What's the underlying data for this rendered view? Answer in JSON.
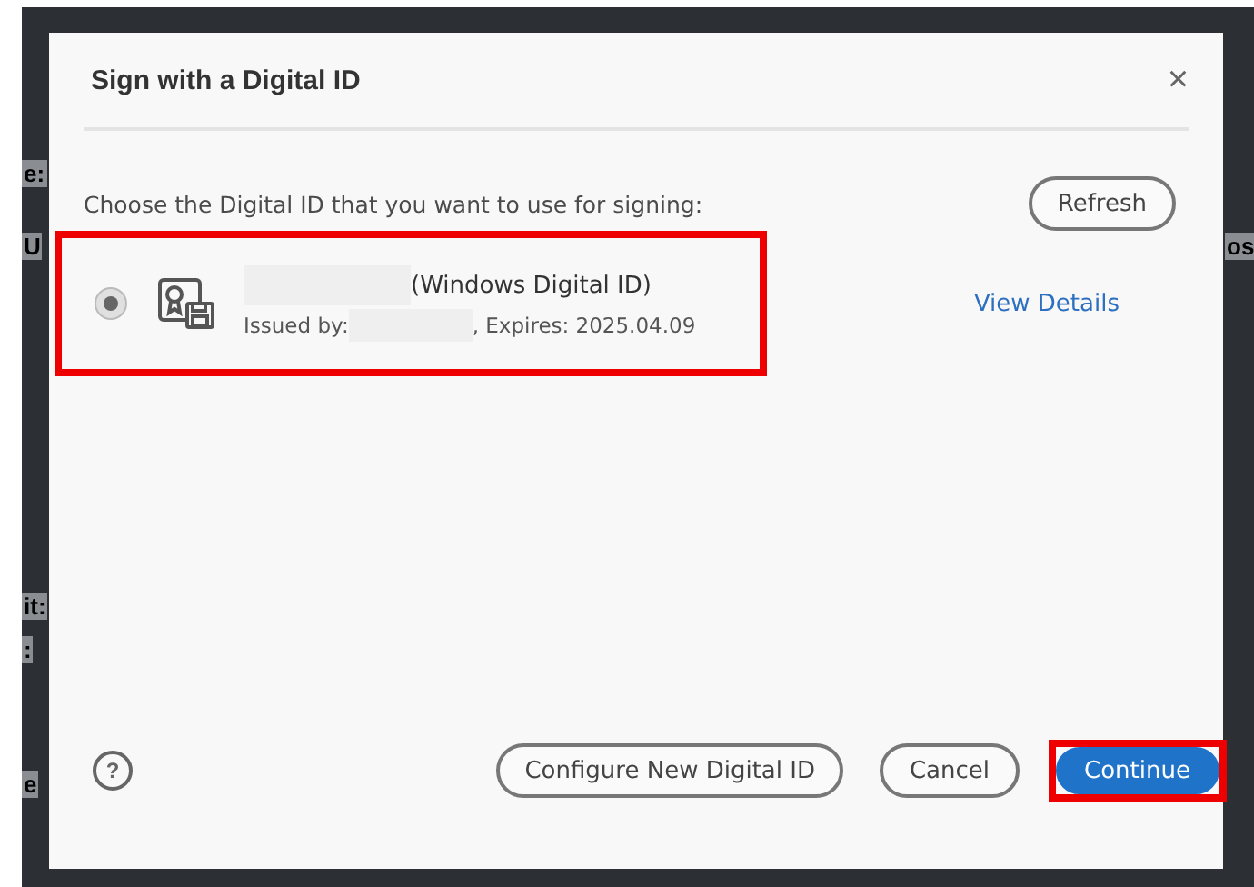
{
  "backdrop": {
    "left_fragments": [
      "e:",
      "U",
      "it:",
      ":",
      "e"
    ],
    "right_fragments": [
      "os"
    ]
  },
  "dialog": {
    "title": "Sign with a Digital ID",
    "close": "×",
    "prompt": "Choose the Digital ID that you want to use for signing:",
    "refresh": "Refresh",
    "ids": [
      {
        "selected": true,
        "name_suffix": "(Windows Digital ID)",
        "issued_label": "Issued by:",
        "expires": ", Expires: 2025.04.09",
        "view_details": "View Details",
        "highlighted": true
      }
    ],
    "help": "?",
    "buttons": [
      {
        "label": "Configure New Digital ID",
        "kind": "secondary",
        "highlighted": false
      },
      {
        "label": "Cancel",
        "kind": "secondary",
        "highlighted": false
      },
      {
        "label": "Continue",
        "kind": "primary",
        "highlighted": true
      }
    ]
  }
}
